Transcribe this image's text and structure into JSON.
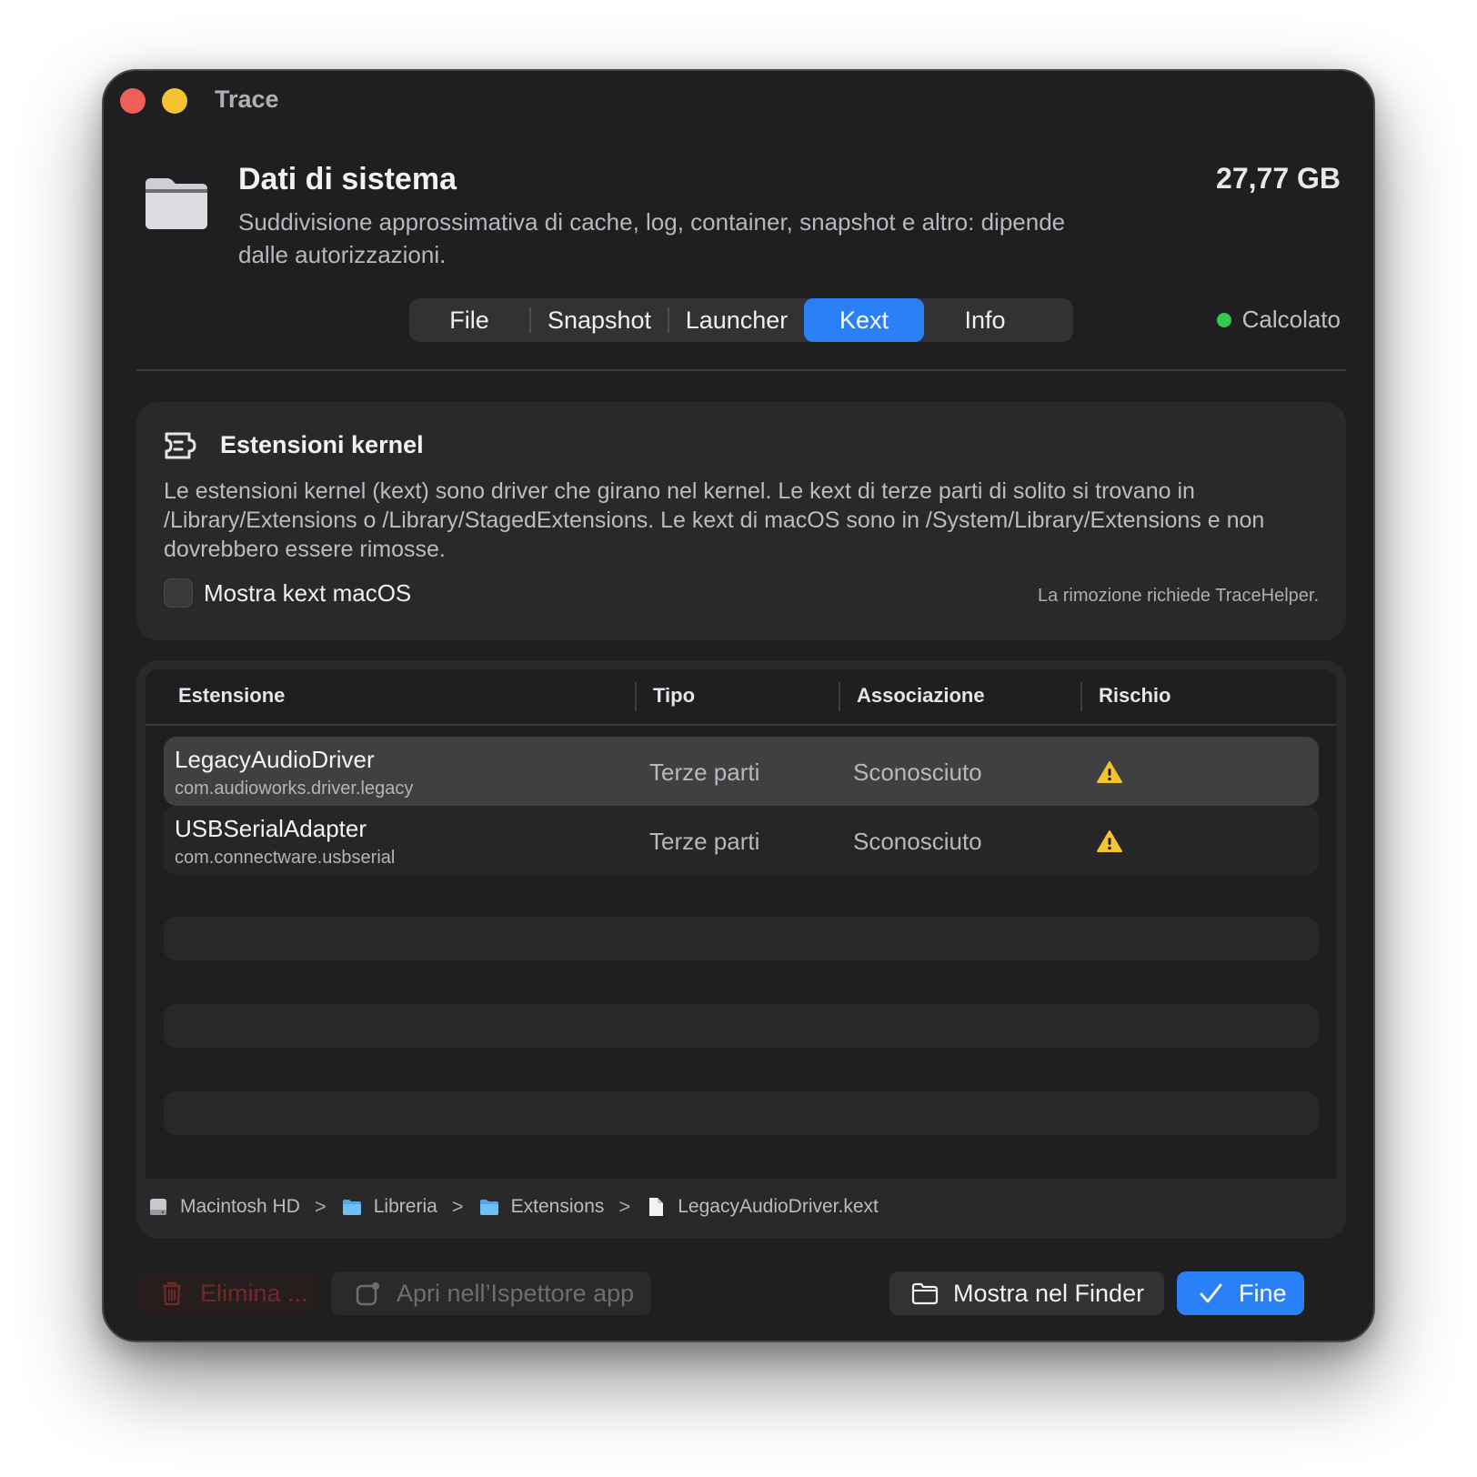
{
  "window": {
    "title": "Trace"
  },
  "header": {
    "title": "Dati di sistema",
    "subtitle": "Suddivisione approssimativa di cache, log, container, snapshot e altro: dipende dalle autorizzazioni.",
    "size": "27,77 GB",
    "icon": "folder-icon"
  },
  "tabs": [
    {
      "label": "File",
      "active": false
    },
    {
      "label": "Snapshot",
      "active": false
    },
    {
      "label": "Launcher",
      "active": false
    },
    {
      "label": "Kext",
      "active": true
    },
    {
      "label": "Info",
      "active": false
    }
  ],
  "status": {
    "label": "Calcolato",
    "color": "#32c94f"
  },
  "info_card": {
    "title": "Estensioni kernel",
    "description": "Le estensioni kernel (kext) sono driver che girano nel kernel. Le kext di terze parti di solito si trovano in /Library/Extensions o /Library/StagedExtensions. Le kext di macOS sono in /System/Library/Extensions e non dovrebbero essere rimosse.",
    "checkbox_label": "Mostra kext macOS",
    "checkbox_checked": false,
    "note": "La rimozione richiede TraceHelper."
  },
  "table": {
    "columns": [
      "Estensione",
      "Tipo",
      "Associazione",
      "Rischio"
    ],
    "rows": [
      {
        "name": "LegacyAudioDriver",
        "bundle_id": "com.audioworks.driver.legacy",
        "type": "Terze parti",
        "association": "Sconosciuto",
        "risk_icon": "warning-icon",
        "selected": true
      },
      {
        "name": "USBSerialAdapter",
        "bundle_id": "com.connectware.usbserial",
        "type": "Terze parti",
        "association": "Sconosciuto",
        "risk_icon": "warning-icon",
        "selected": false
      }
    ]
  },
  "breadcrumb": [
    {
      "label": "Macintosh HD",
      "icon": "disk-icon"
    },
    {
      "label": "Libreria",
      "icon": "folder-icon"
    },
    {
      "label": "Extensions",
      "icon": "folder-icon"
    },
    {
      "label": "LegacyAudioDriver.kext",
      "icon": "file-icon"
    }
  ],
  "buttons": {
    "delete": "Elimina ...",
    "inspector": "Apri nell’Ispettore app",
    "finder": "Mostra nel Finder",
    "done": "Fine"
  },
  "colors": {
    "accent": "#2a80f6",
    "warning": "#f5c331",
    "delete": "#6e2a2a"
  }
}
